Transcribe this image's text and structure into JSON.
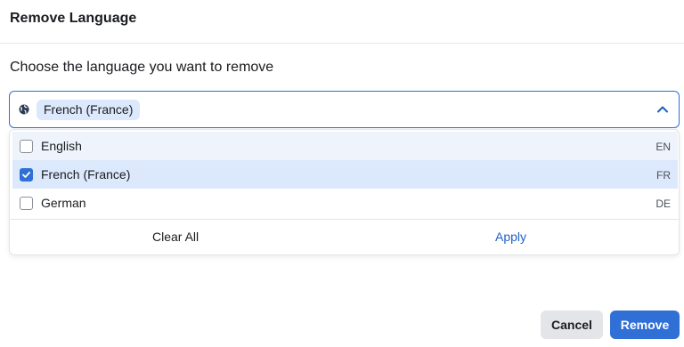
{
  "dialog": {
    "title": "Remove Language",
    "prompt": "Choose the language you want to remove"
  },
  "select": {
    "selected_chip": "French (France)",
    "icon": "globe-icon",
    "toggle_icon": "chevron-up-icon"
  },
  "options": [
    {
      "label": "English",
      "code": "EN",
      "checked": false
    },
    {
      "label": "French (France)",
      "code": "FR",
      "checked": true
    },
    {
      "label": "German",
      "code": "DE",
      "checked": false
    }
  ],
  "dropdown_actions": {
    "clear_all": "Clear All",
    "apply": "Apply"
  },
  "buttons": {
    "cancel": "Cancel",
    "remove": "Remove"
  },
  "colors": {
    "accent": "#2f6fd6",
    "chip_bg": "#dce8fb",
    "apply_text": "#1f5fc4"
  }
}
